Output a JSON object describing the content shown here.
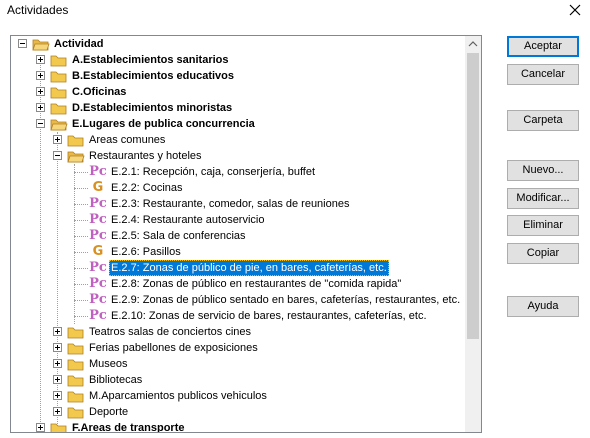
{
  "window": {
    "title": "Actividades",
    "close_icon": "close-icon"
  },
  "buttons": {
    "accept": "Aceptar",
    "cancel": "Cancelar",
    "folder": "Carpeta",
    "new": "Nuevo...",
    "modify": "Modificar...",
    "delete": "Eliminar",
    "copy": "Copiar",
    "help": "Ayuda"
  },
  "tree": {
    "root": "Actividad",
    "categories": [
      "A.Establecimientos sanitarios",
      "B.Establecimientos educativos",
      "C.Oficinas",
      "D.Establecimientos minoristas",
      "E.Lugares de publica concurrencia"
    ],
    "e_children": {
      "areas": "Areas comunes",
      "restaurants": "Restaurantes y hoteles",
      "items": [
        {
          "icon": "Pc",
          "label": "E.2.1: Recepción, caja, conserjería, buffet"
        },
        {
          "icon": "G",
          "label": "E.2.2: Cocinas"
        },
        {
          "icon": "Pc",
          "label": "E.2.3: Restaurante, comedor, salas de reuniones"
        },
        {
          "icon": "Pc",
          "label": "E.2.4: Restaurante autoservicio"
        },
        {
          "icon": "Pc",
          "label": "E.2.5: Sala de conferencias"
        },
        {
          "icon": "G",
          "label": "E.2.6: Pasillos"
        },
        {
          "icon": "Pc",
          "label": "E.2.7: Zonas de público de pie, en bares, cafeterías, etc."
        },
        {
          "icon": "Pc",
          "label": "E.2.8: Zonas de público en restaurantes de \"comida rapida\""
        },
        {
          "icon": "Pc",
          "label": "E.2.9: Zonas de público sentado en bares, cafeterías, restaurantes, etc."
        },
        {
          "icon": "Pc",
          "label": "E.2.10: Zonas de servicio de bares, restaurantes, cafeterías, etc."
        }
      ],
      "others": [
        "Teatros salas de conciertos cines",
        "Ferias pabellones de exposiciones",
        "Museos",
        "Bibliotecas",
        "M.Aparcamientos publicos vehiculos",
        "Deporte"
      ]
    },
    "partial_last": "F.Areas de transporte",
    "selected": "E.2.7: Zonas de público de pie, en bares, cafeterías, etc."
  },
  "colors": {
    "selection": "#0078d7",
    "pc_icon": "#c060c0",
    "g_icon": "#d89020",
    "folder": "#f2c94c"
  }
}
